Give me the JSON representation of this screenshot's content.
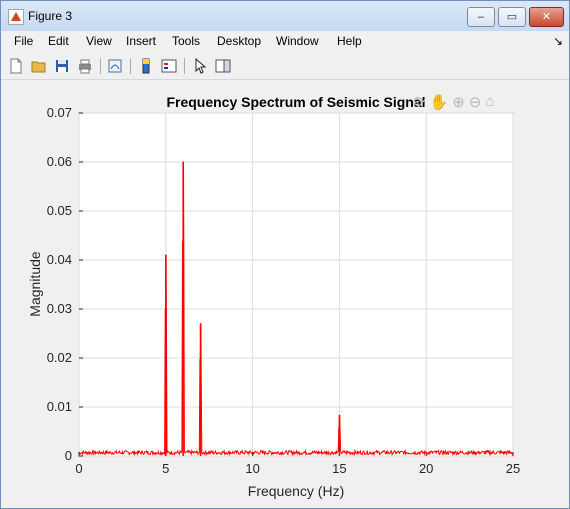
{
  "window": {
    "title": "Figure 3"
  },
  "title_buttons": {
    "minimize": "–",
    "maximize": "▭",
    "close": "✕"
  },
  "menu": [
    "File",
    "Edit",
    "View",
    "Insert",
    "Tools",
    "Desktop",
    "Window",
    "Help"
  ],
  "toolbar_icons": [
    "new-figure-icon",
    "open-file-icon",
    "save-icon",
    "print-icon",
    "link-plot-icon",
    "insert-colorbar-icon",
    "insert-legend-icon",
    "edit-plot-icon",
    "property-inspector-icon"
  ],
  "axes_toolbar_icons": [
    "rotate-icon",
    "pan-icon",
    "zoom-in-icon",
    "zoom-out-icon",
    "home-icon"
  ],
  "chart_data": {
    "type": "line",
    "title": "Frequency Spectrum of Seismic Signal",
    "xlabel": "Frequency (Hz)",
    "ylabel": "Magnitude",
    "xlim": [
      0,
      25
    ],
    "ylim": [
      0,
      0.07
    ],
    "xticks": [
      0,
      5,
      10,
      15,
      20,
      25
    ],
    "yticks": [
      0,
      0.01,
      0.02,
      0.03,
      0.04,
      0.05,
      0.06,
      0.07
    ],
    "ytick_labels": [
      "0",
      "0.01",
      "0.02",
      "0.03",
      "0.04",
      "0.05",
      "0.06",
      "0.07"
    ],
    "grid": true,
    "line_color": "#ff0000",
    "noise_floor": 0.001,
    "peaks": [
      {
        "x": 5.0,
        "y": 0.041
      },
      {
        "x": 6.0,
        "y": 0.06
      },
      {
        "x": 7.0,
        "y": 0.027
      },
      {
        "x": 15.0,
        "y": 0.0083
      }
    ]
  }
}
